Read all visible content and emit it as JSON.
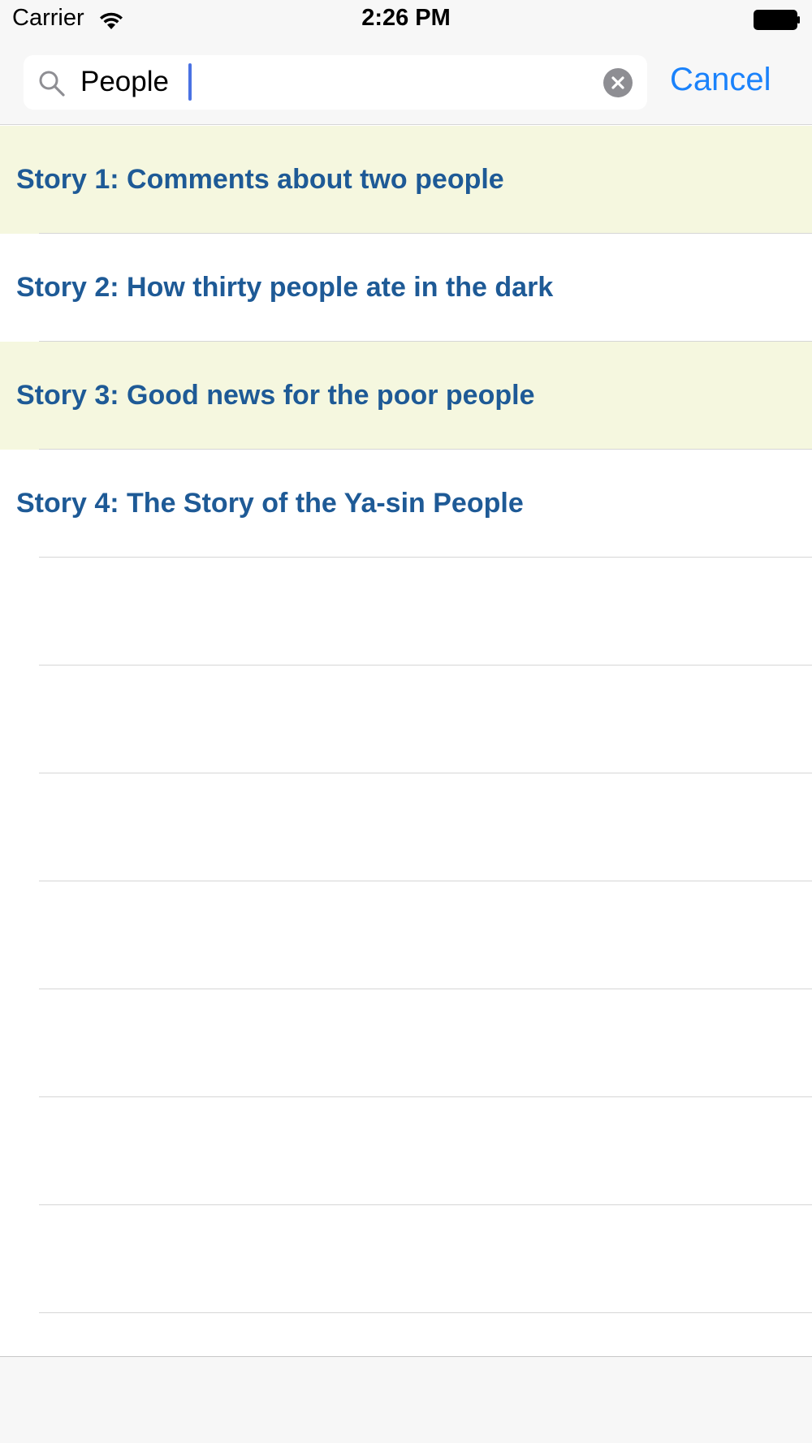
{
  "status_bar": {
    "carrier": "Carrier",
    "time": "2:26 PM",
    "wifi_icon": "wifi-icon",
    "battery_icon": "battery-icon"
  },
  "search": {
    "value": "People",
    "icon": "search-icon",
    "clear_icon": "clear-icon",
    "cancel_label": "Cancel"
  },
  "results": [
    {
      "label": "Story 1: Comments about two people",
      "highlighted": true
    },
    {
      "label": "Story 2: How thirty people ate in the dark",
      "highlighted": false
    },
    {
      "label": "Story 3: Good news for the poor people",
      "highlighted": true
    },
    {
      "label": "Story 4: The Story of the Ya-sin People",
      "highlighted": false
    },
    {
      "label": "",
      "highlighted": false
    },
    {
      "label": "",
      "highlighted": false
    },
    {
      "label": "",
      "highlighted": false
    },
    {
      "label": "",
      "highlighted": false
    },
    {
      "label": "",
      "highlighted": false
    },
    {
      "label": "",
      "highlighted": false
    },
    {
      "label": "",
      "highlighted": false
    }
  ],
  "colors": {
    "highlight_row": "#f5f7df",
    "row_text": "#1e5a96",
    "accent": "#1a82fb",
    "bar_background": "#f7f7f7"
  }
}
